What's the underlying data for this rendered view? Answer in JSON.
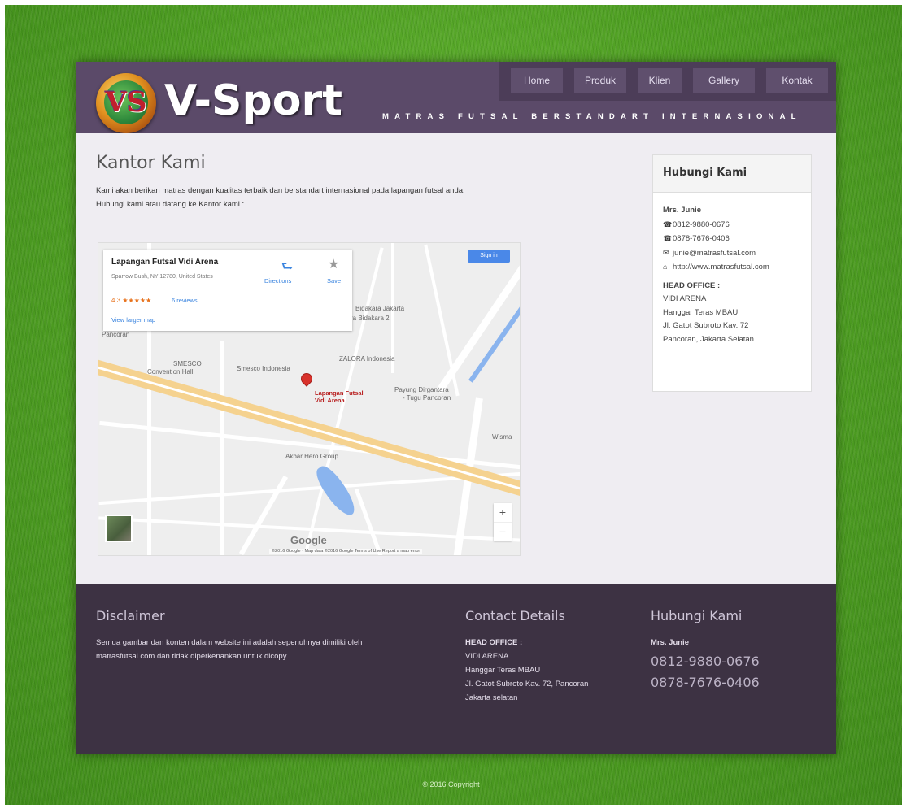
{
  "header": {
    "brand": "V-Sport",
    "logo_monogram": "VS",
    "tagline": "MATRAS FUTSAL BERSTANDART INTERNASIONAL"
  },
  "nav": {
    "items": [
      "Home",
      "Produk",
      "Klien",
      "Gallery",
      "Kontak"
    ]
  },
  "main": {
    "title": "Kantor Kami",
    "intro_line1": "Kami akan berikan matras dengan kualitas terbaik dan berstandart internasional pada lapangan futsal anda.",
    "intro_line2": "Hubungi kami atau datang ke Kantor kami :"
  },
  "map": {
    "place_name": "Lapangan Futsal Vidi Arena",
    "address": "Sparrow Bush, NY 12780, United States",
    "rating": "4.3 ★★★★★",
    "reviews": "6 reviews",
    "larger_map": "View larger map",
    "directions": "Directions",
    "save": "Save",
    "sign_in": "Sign in",
    "pin_label_1": "Lapangan Futsal",
    "pin_label_2": "Vidi Arena",
    "labels": {
      "smesco": "SMESCO",
      "convention": "Convention Hall",
      "smesco_indo": "Smesco Indonesia",
      "zalora": "ZALORA Indonesia",
      "payung": "Payung Dirgantara",
      "tugu": "- Tugu Pancoran",
      "akbar": "Akbar Hero Group",
      "bidakara": "Bidakara Jakarta",
      "bidakara2": "ra Bidakara 2",
      "pancoran": "Pancoran",
      "wisma": "Wisma"
    },
    "zoom_in": "+",
    "zoom_out": "−",
    "google": "Google",
    "attribution": "©2016 Google · Map data ©2016 Google   Terms of Use   Report a map error"
  },
  "contact_box": {
    "title": "Hubungi Kami",
    "name": "Mrs. Junie",
    "phone1": "0812-9880-0676",
    "phone2": "0878-7676-0406",
    "email": "junie@matrasfutsal.com",
    "website": "http://www.matrasfutsal.com",
    "office_label": "HEAD OFFICE :",
    "office_line1": "VIDI ARENA",
    "office_line2": "Hanggar Teras MBAU",
    "office_line3": "Jl. Gatot Subroto Kav. 72",
    "office_line4": "Pancoran, Jakarta Selatan"
  },
  "footer": {
    "disclaimer_title": "Disclaimer",
    "disclaimer_line1": "Semua gambar dan konten dalam website ini adalah sepenuhnya dimiliki oleh",
    "disclaimer_line2": "matrasfutsal.com dan tidak diperkenankan untuk dicopy.",
    "contact_title": "Contact Details",
    "office_label": "HEAD OFFICE :",
    "office_line1": "VIDI ARENA",
    "office_line2": "Hanggar Teras MBAU",
    "office_line3": "Jl. Gatot Subroto Kav. 72, Pancoran",
    "office_line4": "Jakarta selatan",
    "hubungi_title": "Hubungi Kami",
    "name": "Mrs. Junie",
    "phone1": "0812-9880-0676",
    "phone2": "0878-7676-0406"
  },
  "copyright": "© 2016 Copyright",
  "icons": {
    "phone": "☎",
    "email": "✉",
    "website": "⌂",
    "directions": "⮑",
    "save": "★"
  },
  "colors": {
    "header": "#5b4a69",
    "nav": "#4c3d58",
    "content": "#efedf2",
    "footer": "#3d3243"
  }
}
